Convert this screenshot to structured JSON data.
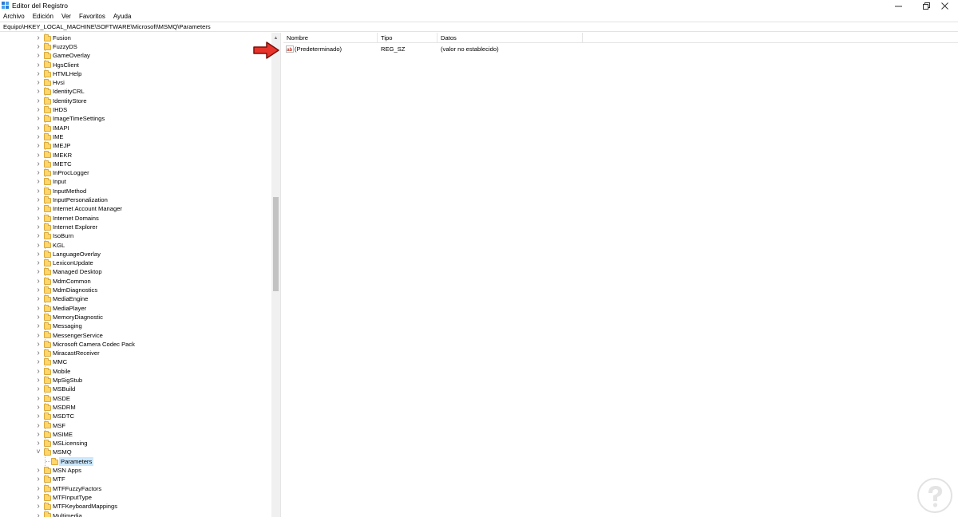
{
  "window": {
    "title": "Editor del Registro",
    "minimize_icon": "minimize-icon",
    "maximize_icon": "restore-icon",
    "close_icon": "close-icon"
  },
  "menu": {
    "items": [
      "Archivo",
      "Edición",
      "Ver",
      "Favoritos",
      "Ayuda"
    ]
  },
  "address": {
    "path": "Equipo\\HKEY_LOCAL_MACHINE\\SOFTWARE\\Microsoft\\MSMQ\\Parameters"
  },
  "tree": {
    "items": [
      "Fusion",
      "FuzzyDS",
      "GameOverlay",
      "HgsClient",
      "HTMLHelp",
      "Hvsi",
      "IdentityCRL",
      "IdentityStore",
      "IHDS",
      "ImageTimeSettings",
      "IMAPI",
      "IME",
      "IMEJP",
      "IMEKR",
      "IMETC",
      "InProcLogger",
      "Input",
      "InputMethod",
      "InputPersonalization",
      "Internet Account Manager",
      "Internet Domains",
      "Internet Explorer",
      "IsoBurn",
      "KGL",
      "LanguageOverlay",
      "LexiconUpdate",
      "Managed Desktop",
      "MdmCommon",
      "MdmDiagnostics",
      "MediaEngine",
      "MediaPlayer",
      "MemoryDiagnostic",
      "Messaging",
      "MessengerService",
      "Microsoft Camera Codec Pack",
      "MiracastReceiver",
      "MMC",
      "Mobile",
      "MpSigStub",
      "MSBuild",
      "MSDE",
      "MSDRM",
      "MSDTC",
      "MSF",
      "MSIME",
      "MSLicensing",
      "MSMQ",
      "Parameters",
      "MSN Apps",
      "MTF",
      "MTFFuzzyFactors",
      "MTFInputType",
      "MTFKeyboardMappings",
      "Multimedia"
    ],
    "expanded_item": "MSMQ",
    "selected_item": "Parameters"
  },
  "list": {
    "columns": [
      "Nombre",
      "Tipo",
      "Datos"
    ],
    "rows": [
      {
        "name": "(Predeterminado)",
        "type": "REG_SZ",
        "data": "(valor no establecido)",
        "icon": "string-value-icon"
      }
    ]
  },
  "colors": {
    "selection": "#cce8ff",
    "folder": "#ffd66b",
    "annotation_arrow": "#e8332a"
  }
}
